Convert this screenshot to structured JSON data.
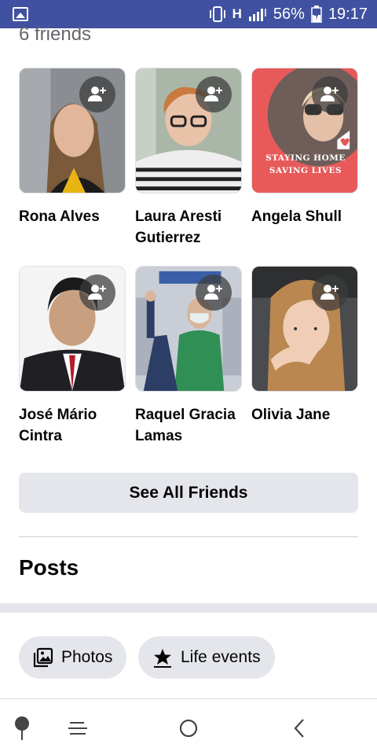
{
  "status_bar": {
    "network": "H",
    "battery_percent": "56%",
    "time": "19:17",
    "icons": [
      "image-icon",
      "vibrate-icon",
      "signal-icon",
      "battery-charging-icon"
    ]
  },
  "friends_section": {
    "count_label": "6 friends",
    "friends": [
      {
        "name": "Rona Alves",
        "action_icon": "add-friend-icon"
      },
      {
        "name": "Laura Aresti Gutierrez",
        "action_icon": "add-friend-icon"
      },
      {
        "name": "Angela Shull",
        "action_icon": "add-friend-icon",
        "photo_caption": "STAYING HOME SAVING LIVES"
      },
      {
        "name": "José Mário Cintra",
        "action_icon": "add-friend-icon"
      },
      {
        "name": "Raquel Gracia Lamas",
        "action_icon": "add-friend-icon"
      },
      {
        "name": "Olivia Jane",
        "action_icon": "add-friend-icon"
      }
    ],
    "see_all_label": "See All Friends"
  },
  "posts_section": {
    "title": "Posts",
    "chips": [
      {
        "label": "Photos",
        "icon": "photos-icon"
      },
      {
        "label": "Life events",
        "icon": "life-event-star-icon"
      }
    ]
  },
  "nav_bar": {
    "items": [
      "pin-icon",
      "menu-icon",
      "home-circle-icon",
      "back-icon"
    ]
  },
  "colors": {
    "status_bar_bg": "#3f51a0",
    "button_bg": "#e4e6eb",
    "text_primary": "#050505",
    "text_secondary": "#65676b",
    "promo_red": "#e85a5a"
  }
}
